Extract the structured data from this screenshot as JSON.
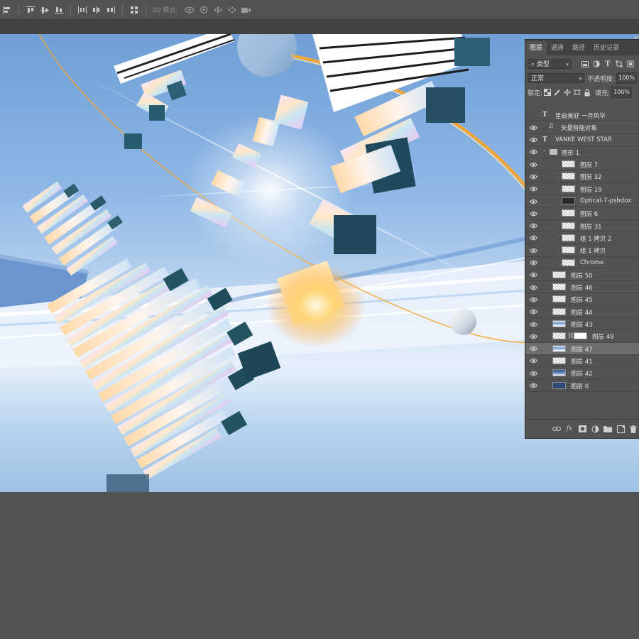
{
  "options_bar": {
    "mode_3d_label": "3D 模式:",
    "icons": [
      "align-left-edges-icon",
      "align-top-edges-icon",
      "align-vertical-centers-icon",
      "align-bottom-edges-icon",
      "distribute-horizontal-icon",
      "distribute-centers-icon",
      "distribute-right-icon",
      "auto-align-icon",
      "orbit-3d-icon",
      "roll-3d-icon",
      "pan-3d-icon",
      "slide-3d-icon",
      "scale-3d-icon"
    ]
  },
  "colors": {
    "app_bg": "#535353",
    "panel_header": "#424242",
    "canvas_sky_top": "#6f9fd6",
    "canvas_horizon": "#e6f0fb",
    "accent_orange": "#f7a531"
  },
  "panel": {
    "tabs": [
      {
        "label": "图层",
        "active": true
      },
      {
        "label": "通道",
        "active": false
      },
      {
        "label": "路径",
        "active": false
      },
      {
        "label": "历史记录",
        "active": false
      }
    ],
    "filter_kind": "类型",
    "blend_mode": "正常",
    "opacity_label": "不透明度:",
    "opacity_value": "100%",
    "lock_label": "锁定:",
    "fill_label": "填充:",
    "fill_value": "100%",
    "layers": [
      {
        "name": "星启美好 一月风华",
        "kind": "type",
        "visible": false,
        "indent": 0
      },
      {
        "name": "矢量智能对象",
        "kind": "smart",
        "visible": true,
        "indent": 0
      },
      {
        "name": "VANKE WEST STAR",
        "kind": "type",
        "visible": true,
        "indent": 0
      },
      {
        "name": "图形 1",
        "kind": "group",
        "visible": true,
        "indent": 0
      },
      {
        "name": "图层 7",
        "kind": "pixel",
        "visible": true,
        "indent": 1
      },
      {
        "name": "图层 32",
        "kind": "pixel",
        "visible": true,
        "indent": 1
      },
      {
        "name": "图层 19",
        "kind": "pixel",
        "visible": true,
        "indent": 1
      },
      {
        "name": "Optical-7-psbdox",
        "kind": "smart",
        "visible": true,
        "indent": 1
      },
      {
        "name": "图层 6",
        "kind": "pixel",
        "visible": true,
        "indent": 1
      },
      {
        "name": "图层 31",
        "kind": "pixel",
        "visible": true,
        "indent": 1
      },
      {
        "name": "组 1 拷贝 2",
        "kind": "pixel",
        "visible": true,
        "indent": 1
      },
      {
        "name": "组 1 拷贝",
        "kind": "pixel",
        "visible": true,
        "indent": 1
      },
      {
        "name": "Chrome",
        "kind": "pixel",
        "visible": true,
        "indent": 1
      },
      {
        "name": "图层 50",
        "kind": "pixel",
        "visible": true,
        "indent": 0
      },
      {
        "name": "图层 46",
        "kind": "pixel",
        "visible": true,
        "indent": 0
      },
      {
        "name": "图层 45",
        "kind": "pixel",
        "visible": true,
        "indent": 0
      },
      {
        "name": "图层 44",
        "kind": "pixel",
        "visible": true,
        "indent": 0
      },
      {
        "name": "图层 43",
        "kind": "pixel-sky",
        "visible": true,
        "indent": 0
      },
      {
        "name": "图层 49",
        "kind": "masked",
        "visible": true,
        "indent": 0
      },
      {
        "name": "图层 47",
        "kind": "pixel-sky",
        "visible": true,
        "indent": 0,
        "selected": true
      },
      {
        "name": "图层 41",
        "kind": "pixel",
        "visible": true,
        "indent": 0
      },
      {
        "name": "图层 42",
        "kind": "pixel-blue",
        "visible": true,
        "indent": 0
      },
      {
        "name": "图层 0",
        "kind": "pixel-navy",
        "visible": true,
        "indent": 0
      }
    ],
    "footer_icons": [
      "link-layers-icon",
      "fx-icon",
      "add-mask-icon",
      "adjustment-layer-icon",
      "new-group-icon",
      "new-layer-icon",
      "delete-layer-icon"
    ],
    "footer_fx_label": "fx"
  }
}
